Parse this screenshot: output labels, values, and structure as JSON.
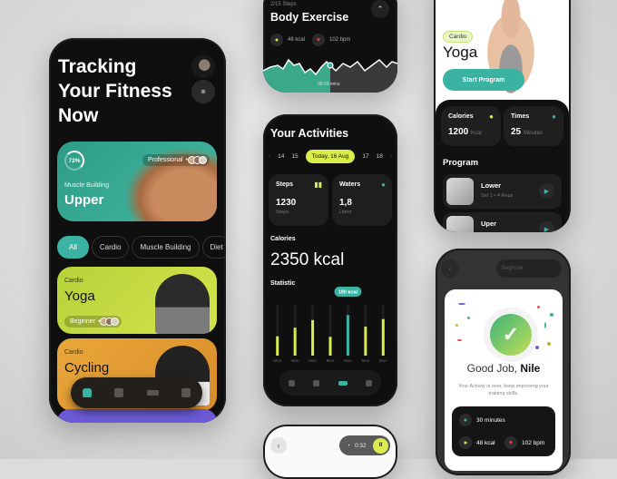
{
  "home": {
    "title": "Tracking Your Fitness Now",
    "featured": {
      "progress": "72%",
      "category": "Muscle Building",
      "name": "Upper",
      "level": "Professional"
    },
    "filters": [
      "All",
      "Cardio",
      "Muscle Building",
      "Diet"
    ],
    "programs": [
      {
        "category": "Cardio",
        "name": "Yoga",
        "level": "Beginner"
      },
      {
        "category": "Cardio",
        "name": "Cycling"
      }
    ]
  },
  "exercise": {
    "steps": "2/15 Steps",
    "title": "Body Exercise",
    "kcal": "48 kcal",
    "bpm": "102 bpm",
    "time": "08:03 mins"
  },
  "activities": {
    "title": "Your Activities",
    "dates": [
      "14",
      "15",
      "Today, 16 Aug",
      "17",
      "18"
    ],
    "steps": {
      "label": "Steps",
      "value": "1230",
      "unit": "Steps"
    },
    "water": {
      "label": "Waters",
      "value": "1,8",
      "unit": "Liters"
    },
    "calories_label": "Calories",
    "calories": "2350 kcal",
    "statistic_label": "Statistic",
    "tooltip": "190 kcal"
  },
  "chart_data": {
    "type": "bar",
    "title": "Statistic",
    "categories": [
      "Mon",
      "Mon",
      "Mon",
      "Mon",
      "Mon",
      "Mon",
      "Mon"
    ],
    "values": [
      0.38,
      0.55,
      0.7,
      0.37,
      0.8,
      0.57,
      0.72
    ],
    "highlight_index": 4,
    "highlight_label": "190 kcal",
    "ylim": [
      0,
      1
    ]
  },
  "workout": {
    "timer": "0:32"
  },
  "yoga": {
    "category": "Cardio",
    "name": "Yoga",
    "cta": "Start Program",
    "calories": {
      "label": "Calories",
      "value": "1200",
      "unit": "Kcal"
    },
    "times": {
      "label": "Times",
      "value": "25",
      "unit": "Minutes"
    },
    "program_label": "Program",
    "items": [
      {
        "name": "Lower",
        "meta": "Set 1 • 4 Reps"
      },
      {
        "name": "Uper",
        "meta": ""
      }
    ]
  },
  "done": {
    "level": "Beginner",
    "greeting": "Good Job,",
    "name": "Nile",
    "message": "Your Activity is over, keep improving your training skills.",
    "duration": "30 minutes",
    "kcal": "48 kcal",
    "bpm": "102 bpm"
  },
  "colors": {
    "teal": "#3bb3a3",
    "lime": "#d9ec4a",
    "orange": "#e9a73a",
    "purple": "#6c5ad6"
  }
}
